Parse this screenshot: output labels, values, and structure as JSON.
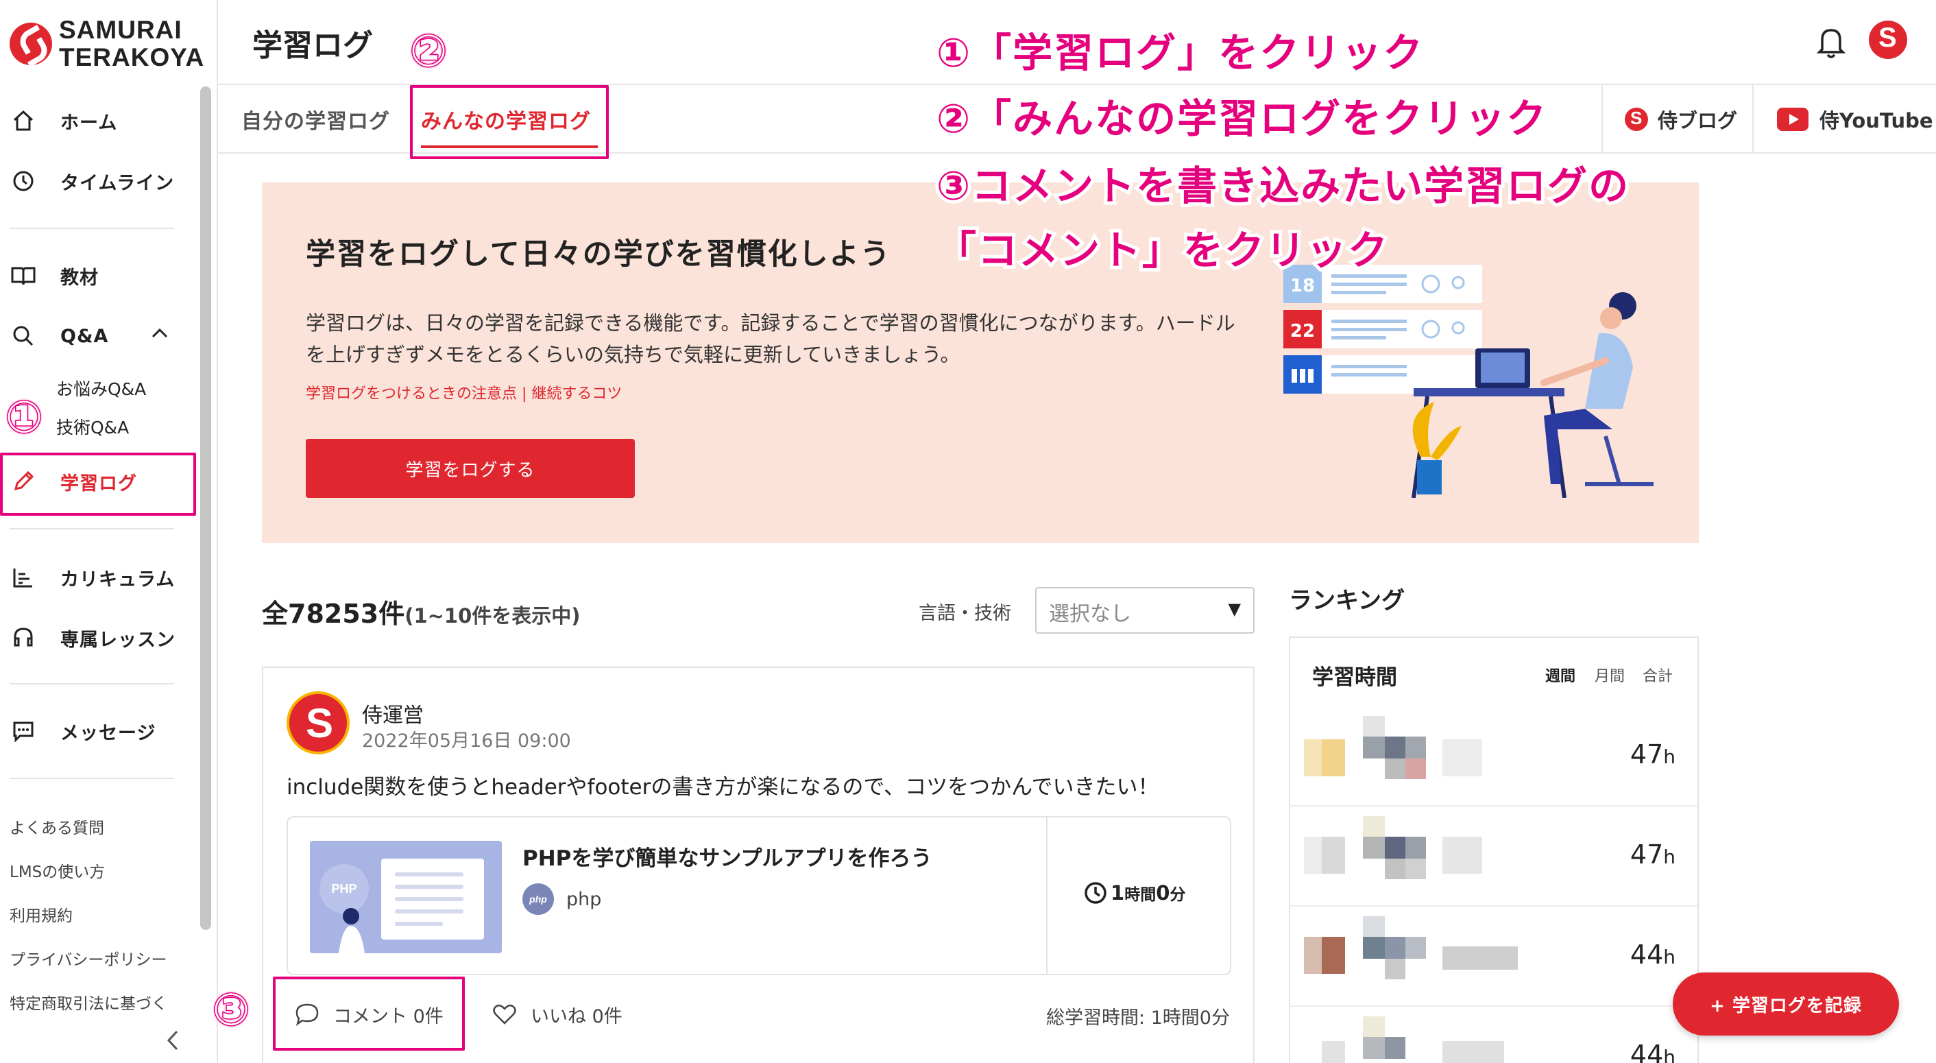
{
  "brand": {
    "line1": "SAMURAI",
    "line2": "TERAKOYA"
  },
  "sidebar": {
    "items": [
      {
        "label": "ホーム"
      },
      {
        "label": "タイムライン"
      },
      {
        "label": "教材"
      },
      {
        "label": "Q&A"
      },
      {
        "label": "学習ログ"
      },
      {
        "label": "カリキュラム"
      },
      {
        "label": "専属レッスン"
      },
      {
        "label": "メッセージ"
      }
    ],
    "qa_sub": [
      "お悩みQ&A",
      "技術Q&A"
    ],
    "footer_links": [
      "よくある質問",
      "LMSの使い方",
      "利用規約",
      "プライバシーポリシー",
      "特定商取引法に基づく"
    ],
    "collapse_icon": "chevron-left-icon"
  },
  "header": {
    "title": "学習ログ",
    "tabs": [
      "自分の学習ログ",
      "みんなの学習ログ"
    ],
    "active_tab": "みんなの学習ログ",
    "links": [
      "侍ブログ",
      "侍YouTube"
    ]
  },
  "annotations": {
    "markers": [
      "①",
      "②",
      "③"
    ],
    "instructions": [
      "①「学習ログ」をクリック",
      "②「みんなの学習ログをクリック",
      "③コメントを書き込みたい学習ログの",
      "「コメント」をクリック"
    ],
    "color": "#e5007e"
  },
  "hero": {
    "title": "学習をログして日々の学びを習慣化しよう",
    "description": "学習ログは、日々の学習を記録できる機能です。記録することで学習の習慣化につながります。ハードルを上げすぎずメモをとるくらいの気持ちで気軽に更新していきましょう。",
    "links": "学習ログをつけるときの注意点 | 継続するコツ",
    "button": "学習をログする",
    "calendar_numbers": [
      "18",
      "22"
    ]
  },
  "feed": {
    "count": "全78253件",
    "count_sub": "(1~10件を表示中)",
    "filter_label": "言語・技術",
    "filter_value": "選択なし"
  },
  "post": {
    "author": "侍運営",
    "date": "2022年05月16日 09:00",
    "body": "include関数を使うとheaderやfooterの書き方が楽になるので、コツをつかんでいきたい！",
    "material_title": "PHPを学び簡単なサンプルアプリを作ろう",
    "thumb_label": "PHP",
    "tag_icon_text": "php",
    "tag": "php",
    "time_hours": "1",
    "time_hours_unit": "時間",
    "time_minutes": "0",
    "time_minutes_unit": "分",
    "comment": "コメント 0件",
    "like": "いいね 0件",
    "total": "総学習時間: 1時間0分"
  },
  "ranking": {
    "title": "ランキング",
    "card_title": "学習時間",
    "periods": [
      "週間",
      "月間",
      "合計"
    ],
    "active_period": "週間",
    "rows": [
      {
        "value": "47",
        "unit": "h"
      },
      {
        "value": "47",
        "unit": "h"
      },
      {
        "value": "44",
        "unit": "h"
      },
      {
        "value": "44",
        "unit": "h"
      }
    ]
  },
  "fab": {
    "label": "+ 学習ログを記録"
  },
  "colors": {
    "brand_red": "#e0262f",
    "hero_bg": "#fbe3d9",
    "annotation": "#e5007e"
  }
}
